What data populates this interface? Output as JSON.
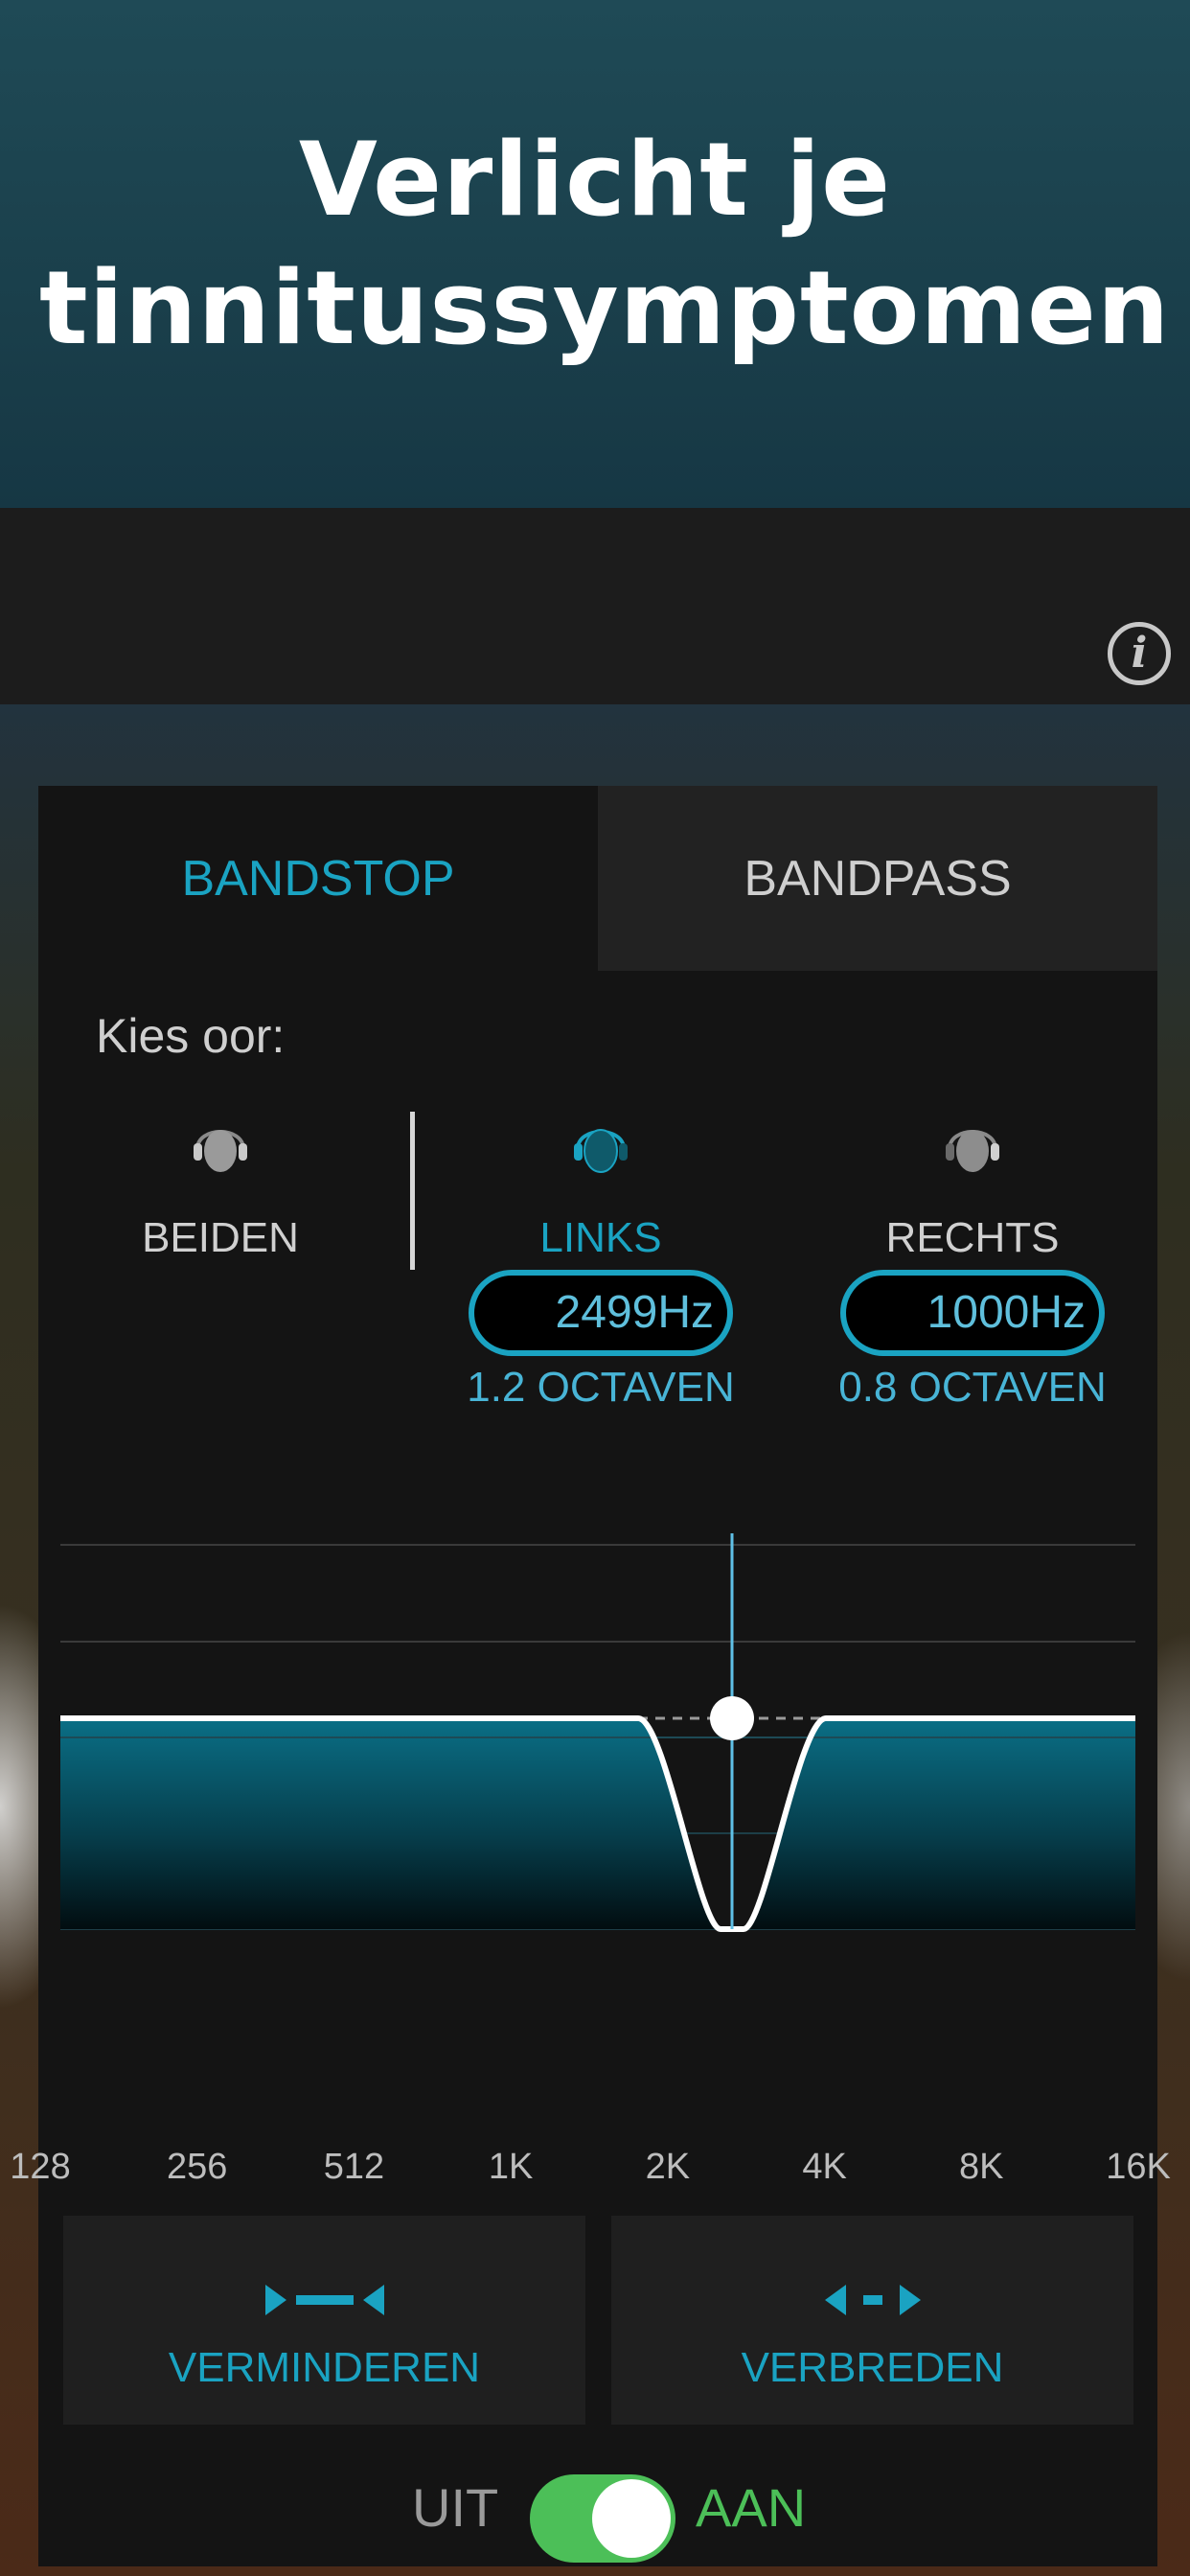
{
  "hero": {
    "title": "Verlicht je tinnitussymptomen"
  },
  "topbar": {
    "info_icon": "info-icon"
  },
  "tabs": [
    {
      "label": "BANDSTOP",
      "active": true
    },
    {
      "label": "BANDPASS",
      "active": false
    }
  ],
  "ear_select": {
    "label": "Kies oor:",
    "options": [
      {
        "label": "BEIDEN",
        "icon": "head-icon"
      },
      {
        "label": "LINKS",
        "icon": "head-left-icon",
        "selected": true,
        "frequency": "2499Hz",
        "octaves": "1.2 OCTAVEN"
      },
      {
        "label": "RECHTS",
        "icon": "head-right-icon",
        "frequency": "1000Hz",
        "octaves": "0.8 OCTAVEN"
      }
    ]
  },
  "chart_data": {
    "type": "line",
    "description_type": "bandstop-filter",
    "x_ticks": [
      "128",
      "256",
      "512",
      "1K",
      "2K",
      "4K",
      "8K",
      "16K"
    ],
    "center_frequency_hz": 2499,
    "bandwidth_octaves": 1.2,
    "x_scale": "log2",
    "grid": true
  },
  "actions": {
    "narrow": {
      "label": "VERMINDEREN",
      "icon": "narrow-icon"
    },
    "widen": {
      "label": "VERBREDEN",
      "icon": "widen-icon"
    }
  },
  "toggle": {
    "off_label": "UIT",
    "on_label": "AAN",
    "state": "on"
  },
  "colors": {
    "accent": "#1aa3c2",
    "toggle_on": "#4cbf58",
    "panel": "#141414"
  }
}
